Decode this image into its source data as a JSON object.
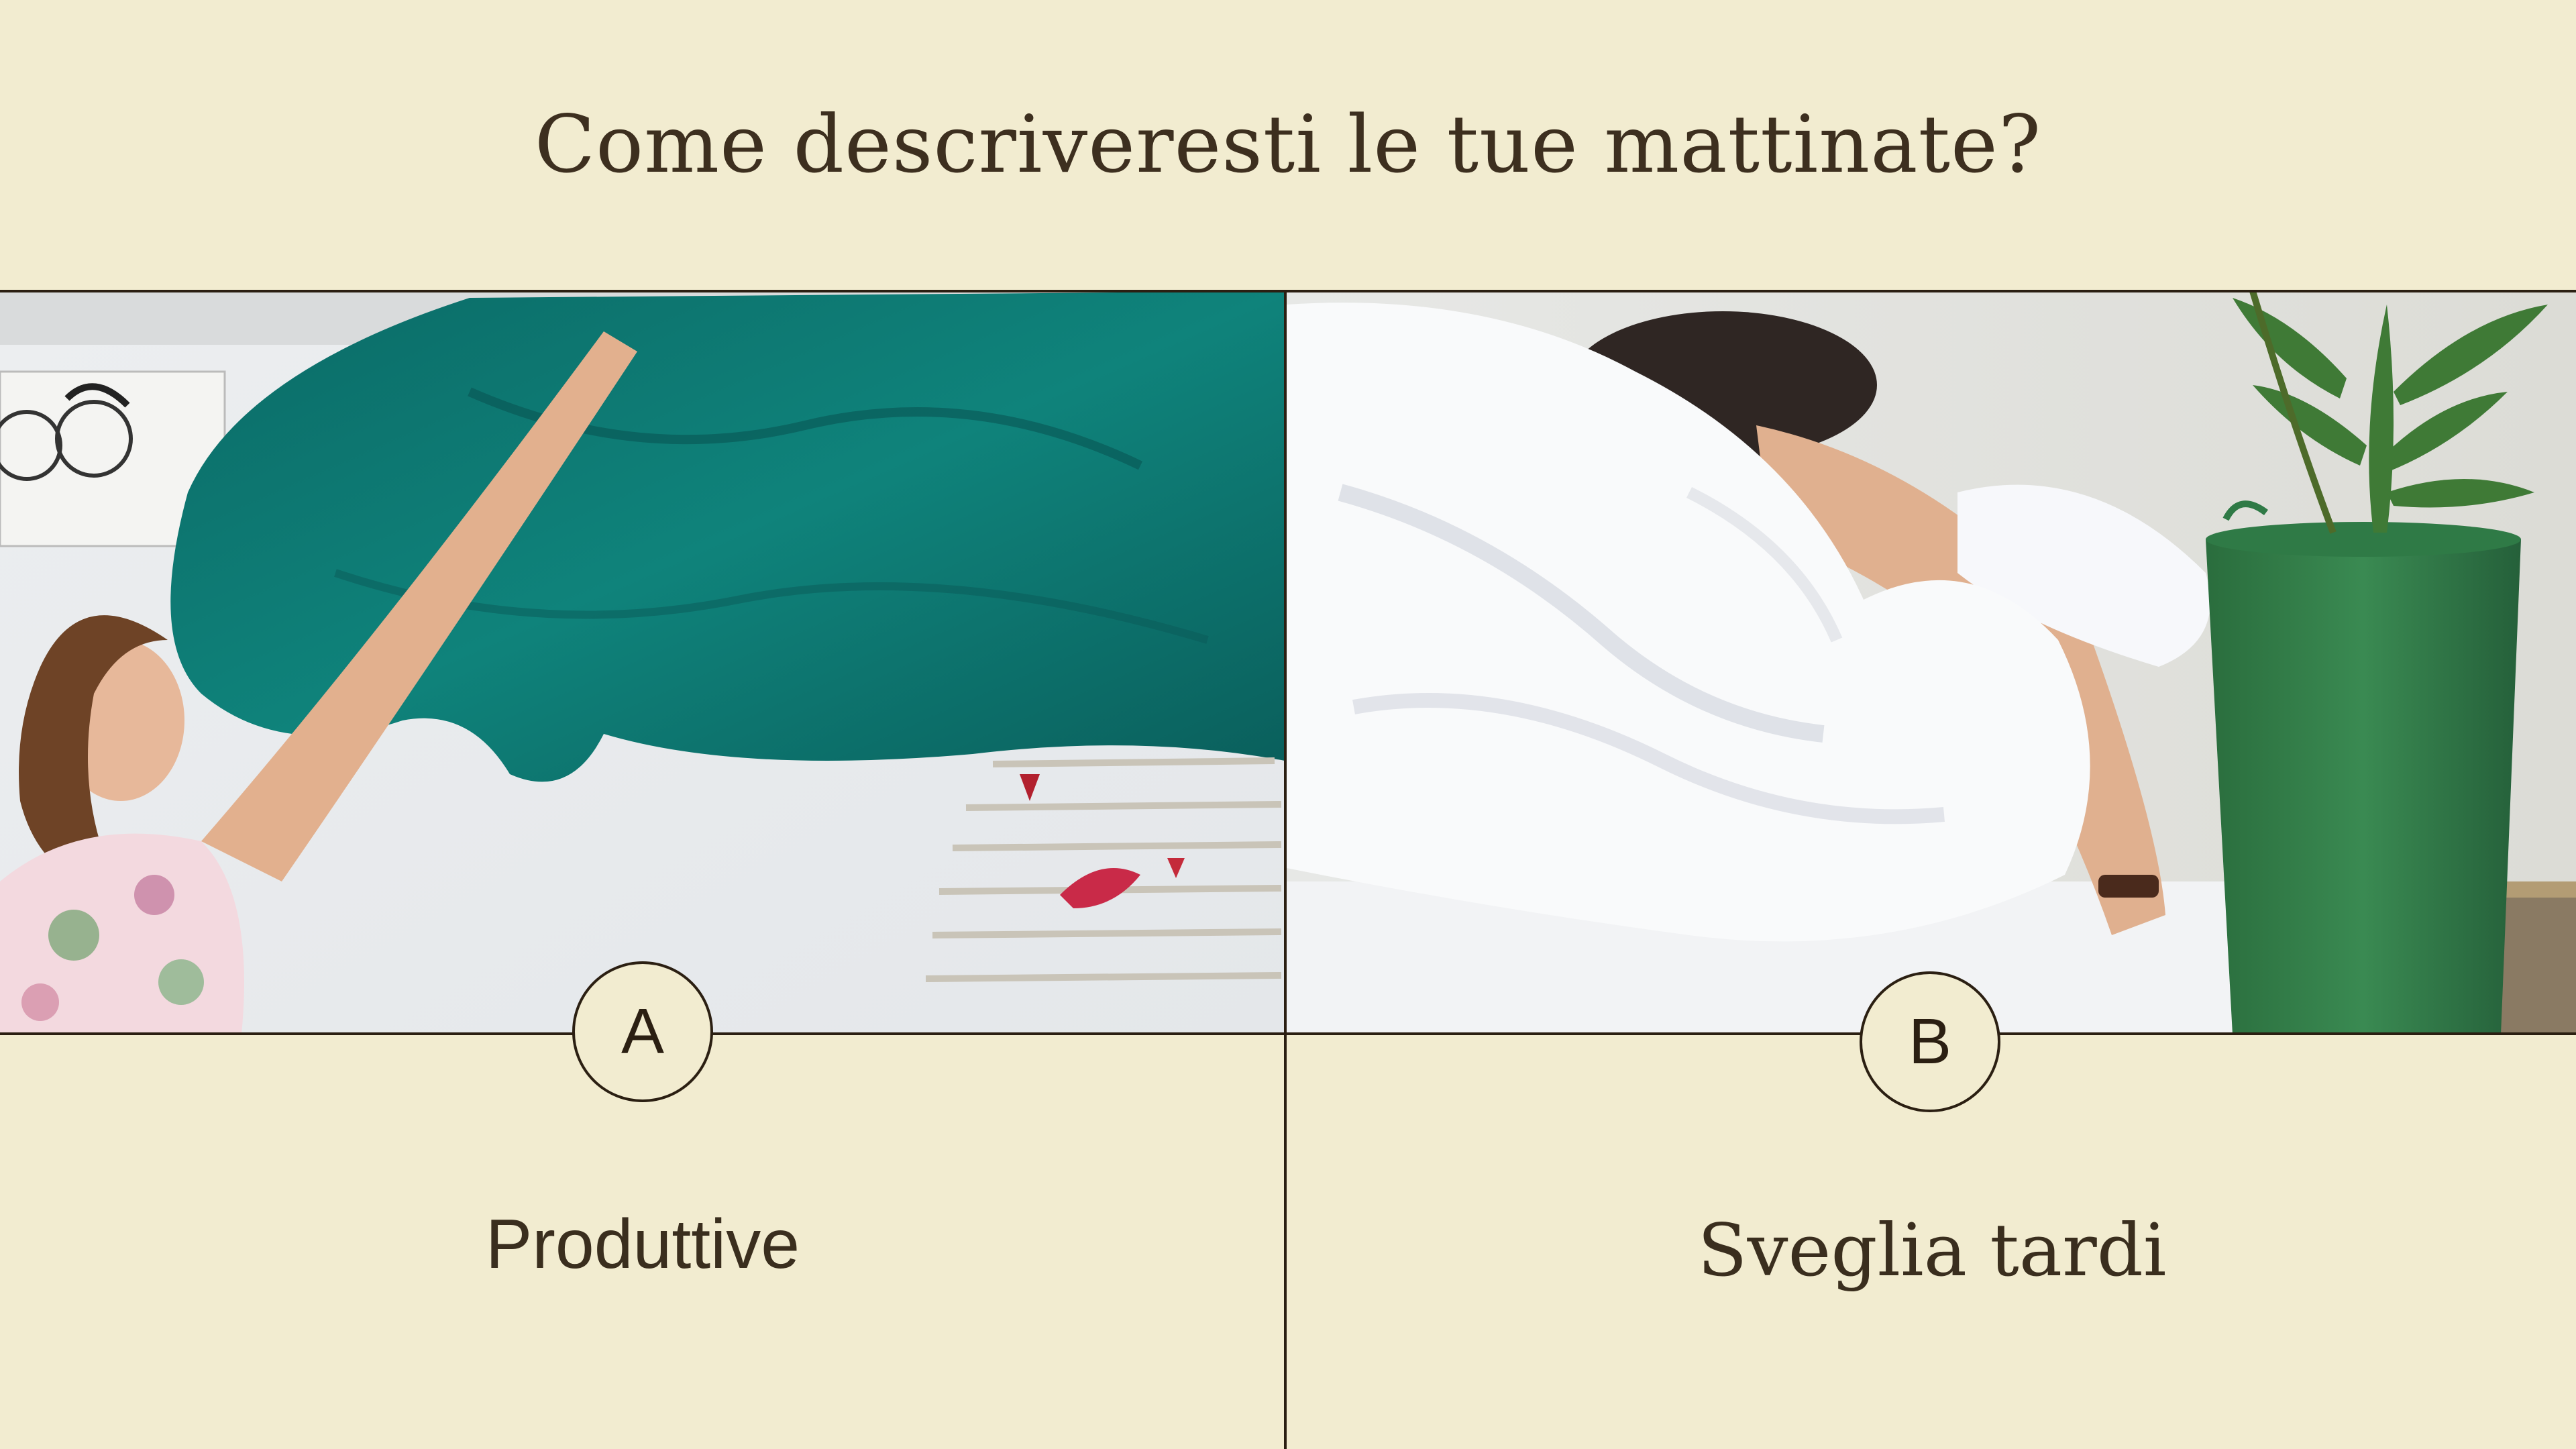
{
  "question": "Come descriveresti le tue mattinate?",
  "options": [
    {
      "letter": "A",
      "label": "Produttive",
      "image_icon": "woman-making-bed-photo"
    },
    {
      "letter": "B",
      "label": "Sveglia tardi",
      "image_icon": "person-sleeping-under-duvet-photo"
    }
  ],
  "colors": {
    "background": "#f2ecd0",
    "text": "#3a2e1e",
    "lines": "#2b1f12",
    "teal_sheet": "#0e7a74",
    "plant_pot": "#2f7d46"
  }
}
